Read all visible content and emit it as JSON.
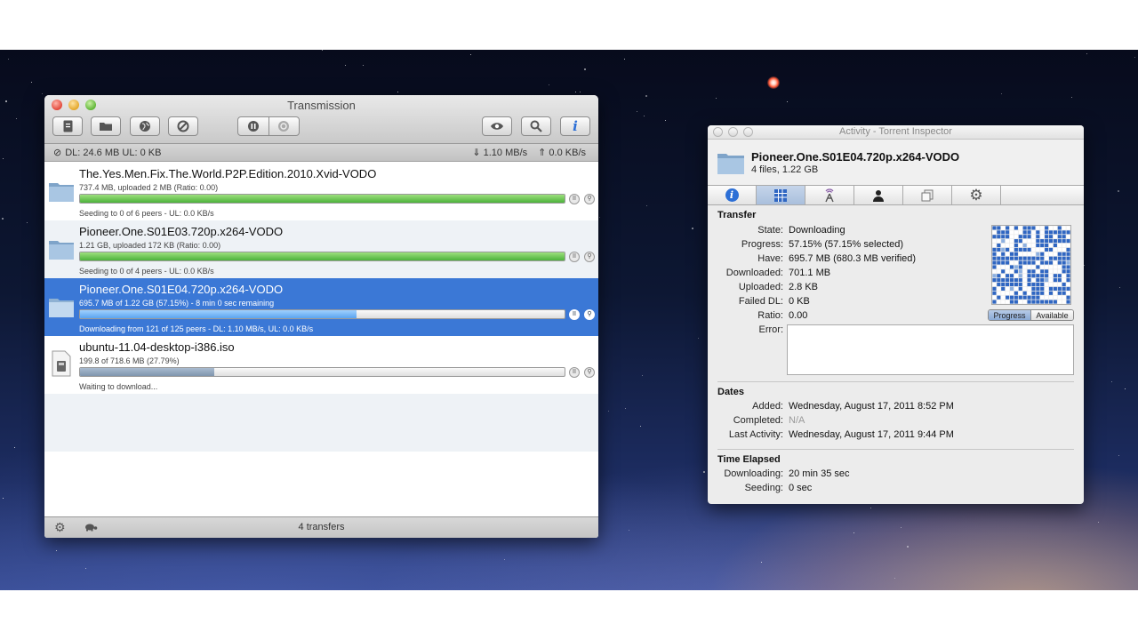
{
  "main_window": {
    "title": "Transmission",
    "status_left": "DL: 24.6 MB  UL: 0 KB",
    "status_down": "1.10 MB/s",
    "status_up": "0.0 KB/s",
    "transfer_count": "4 transfers"
  },
  "torrents": [
    {
      "name": "The.Yes.Men.Fix.The.World.P2P.Edition.2010.Xvid-VODO",
      "meta": "737.4 MB, uploaded 2 MB (Ratio: 0.00)",
      "status": "Seeding to 0 of 6 peers - UL: 0.0 KB/s",
      "progress": 1.0,
      "state": "seeding"
    },
    {
      "name": "Pioneer.One.S01E03.720p.x264-VODO",
      "meta": "1.21 GB, uploaded 172 KB (Ratio: 0.00)",
      "status": "Seeding to 0 of 4 peers - UL: 0.0 KB/s",
      "progress": 1.0,
      "state": "seeding"
    },
    {
      "name": "Pioneer.One.S01E04.720p.x264-VODO",
      "meta": "695.7 MB of 1.22 GB (57.15%) - 8 min 0 sec remaining",
      "status": "Downloading from 121 of 125 peers - DL: 1.10 MB/s, UL: 0.0 KB/s",
      "progress": 0.5715,
      "state": "downloading"
    },
    {
      "name": "ubuntu-11.04-desktop-i386.iso",
      "meta": "199.8 of 718.6 MB (27.79%)",
      "status": "Waiting to download...",
      "progress": 0.2779,
      "state": "waiting"
    }
  ],
  "inspector": {
    "window_title": "Activity - Torrent Inspector",
    "torrent_name": "Pioneer.One.S01E04.720p.x264-VODO",
    "torrent_sub": "4 files, 1.22 GB",
    "transfer": {
      "title": "Transfer",
      "state_label": "State:",
      "state": "Downloading",
      "progress_label": "Progress:",
      "progress": "57.15% (57.15% selected)",
      "have_label": "Have:",
      "have": "695.7 MB (680.3 MB verified)",
      "downloaded_label": "Downloaded:",
      "downloaded": "701.1 MB",
      "uploaded_label": "Uploaded:",
      "uploaded": "2.8 KB",
      "failed_label": "Failed DL:",
      "failed": "0 KB",
      "ratio_label": "Ratio:",
      "ratio": "0.00",
      "error_label": "Error:"
    },
    "pieces_toggle": {
      "progress": "Progress",
      "available": "Available"
    },
    "dates": {
      "title": "Dates",
      "added_label": "Added:",
      "added": "Wednesday, August 17, 2011 8:52 PM",
      "completed_label": "Completed:",
      "completed": "N/A",
      "last_label": "Last Activity:",
      "last": "Wednesday, August 17, 2011 9:44 PM"
    },
    "elapsed": {
      "title": "Time Elapsed",
      "downloading_label": "Downloading:",
      "downloading": "20 min 35 sec",
      "seeding_label": "Seeding:",
      "seeding": "0 sec"
    }
  },
  "colors": {
    "selection": "#3b78d6",
    "seeding_bar": "#4cb33a",
    "download_bar": "#5aa4ef",
    "info_blue": "#2c6fd6"
  }
}
